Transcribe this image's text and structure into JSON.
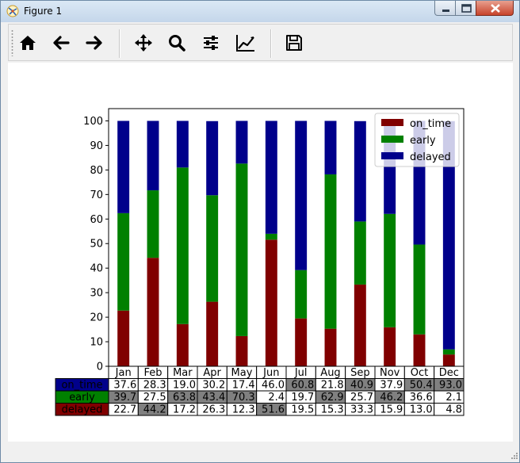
{
  "window": {
    "title": "Figure 1"
  },
  "toolbar": {
    "tools": [
      {
        "name": "home-icon"
      },
      {
        "name": "back-arrow-icon"
      },
      {
        "name": "forward-arrow-icon"
      },
      {
        "name": "pan-move-icon"
      },
      {
        "name": "zoom-magnifier-icon"
      },
      {
        "name": "configure-subplots-icon"
      },
      {
        "name": "edit-axis-curve-icon"
      },
      {
        "name": "save-floppy-icon"
      }
    ]
  },
  "chart_data": {
    "type": "bar",
    "stacked": true,
    "categories": [
      "Jan",
      "Feb",
      "Mar",
      "Apr",
      "May",
      "Jun",
      "Jul",
      "Aug",
      "Sep",
      "Nov",
      "Oct",
      "Dec"
    ],
    "series": [
      {
        "name": "on_time",
        "color": "#800000",
        "values": [
          22.7,
          44.2,
          17.2,
          26.3,
          12.3,
          51.6,
          19.5,
          15.3,
          33.3,
          15.9,
          13.0,
          4.8
        ]
      },
      {
        "name": "early",
        "color": "#008000",
        "values": [
          39.7,
          27.5,
          63.8,
          43.4,
          70.3,
          2.4,
          19.7,
          62.9,
          25.7,
          46.2,
          36.6,
          2.1
        ]
      },
      {
        "name": "delayed",
        "color": "#00008b",
        "values": [
          37.6,
          28.3,
          19.0,
          30.2,
          17.4,
          46.0,
          60.8,
          21.8,
          40.9,
          37.9,
          50.4,
          93.0
        ]
      }
    ],
    "ylim": [
      0,
      105
    ],
    "yticks": [
      0,
      10,
      20,
      30,
      40,
      50,
      60,
      70,
      80,
      90,
      100
    ],
    "legend": "top-right",
    "grid": false,
    "table": {
      "row_order": [
        "delayed",
        "early",
        "on_time"
      ],
      "row_labels": {
        "delayed": "on_time",
        "early": "early",
        "on_time": "delayed"
      },
      "row_label_colors": {
        "delayed": "#00008b",
        "early": "#008000",
        "on_time": "#800000"
      },
      "cells": {
        "delayed": [
          "37.6",
          "28.3",
          "19.0",
          "30.2",
          "17.4",
          "46.0",
          "60.8",
          "21.8",
          "40.9",
          "37.9",
          "50.4",
          "93.0"
        ],
        "early": [
          "39.7",
          "27.5",
          "63.8",
          "43.4",
          "70.3",
          "2.4",
          "19.7",
          "62.9",
          "25.7",
          "46.2",
          "36.6",
          "2.1"
        ],
        "on_time": [
          "22.7",
          "44.2",
          "17.2",
          "26.3",
          "12.3",
          "51.6",
          "19.5",
          "15.3",
          "33.3",
          "15.9",
          "13.0",
          "4.8"
        ]
      },
      "highlight_color": "#808080",
      "highlighted": {
        "delayed": [
          false,
          false,
          false,
          false,
          false,
          false,
          true,
          false,
          true,
          false,
          true,
          true
        ],
        "early": [
          true,
          false,
          true,
          true,
          true,
          false,
          false,
          true,
          false,
          true,
          false,
          false
        ],
        "on_time": [
          false,
          true,
          false,
          false,
          false,
          true,
          false,
          false,
          false,
          false,
          false,
          false
        ]
      }
    }
  }
}
